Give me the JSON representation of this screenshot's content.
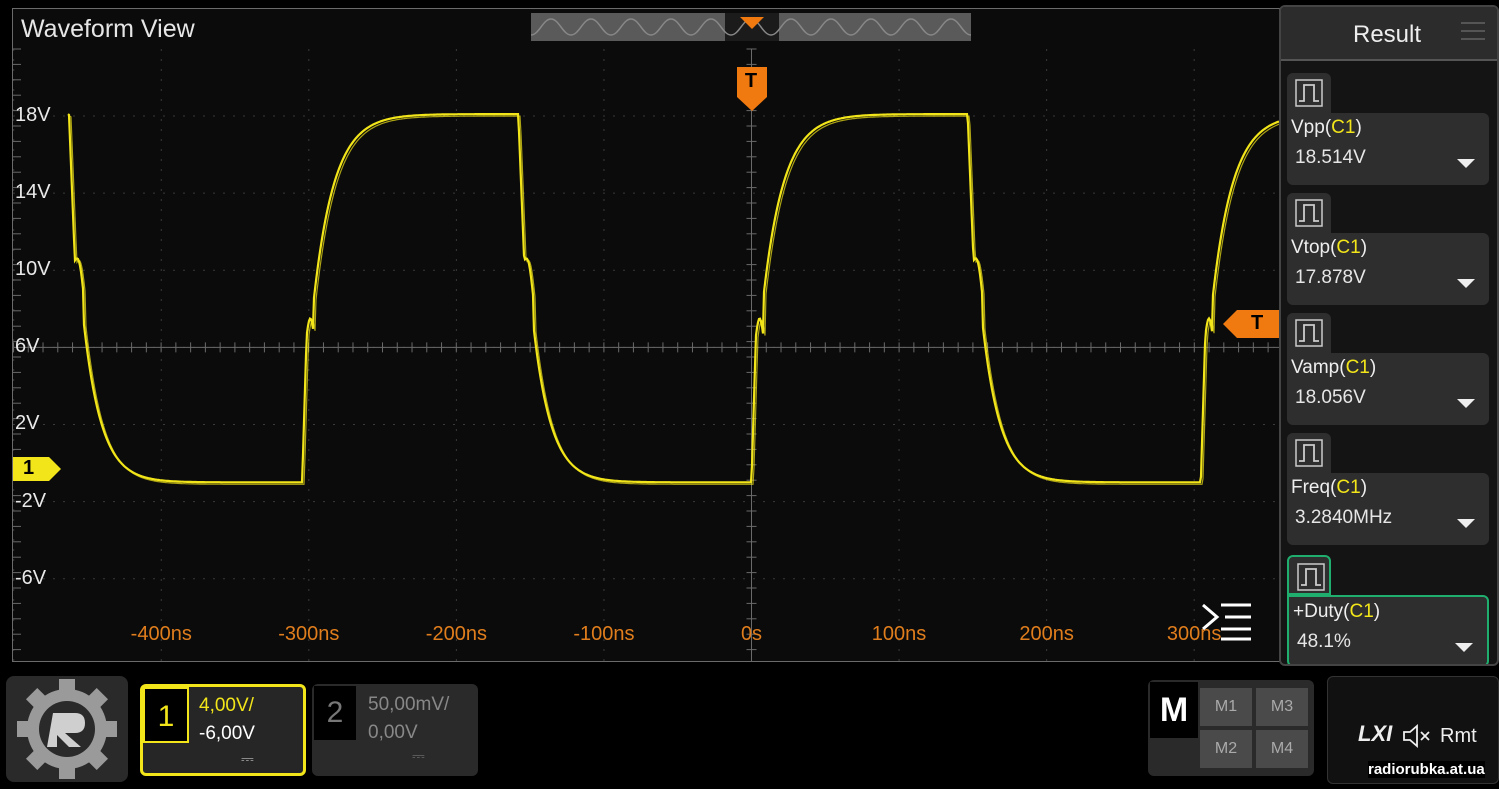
{
  "window": {
    "title": "Waveform View"
  },
  "colors": {
    "ch1": "#f2e51a",
    "trigger": "#f07a10",
    "time_labels": "#e07d1c",
    "active_border": "#1fae6e"
  },
  "waveform": {
    "volt_labels": [
      "18V",
      "14V",
      "10V",
      "6V",
      "2V",
      "-2V",
      "-6V"
    ],
    "time_labels": [
      "-400ns",
      "-300ns",
      "-200ns",
      "-100ns",
      "0s",
      "100ns",
      "200ns",
      "300ns"
    ],
    "channel_marker": "1",
    "trigger_marker": "T",
    "trigger_level_marker": "T"
  },
  "result_panel": {
    "title": "Result",
    "measurements": [
      {
        "name": "Vpp",
        "src": "C1",
        "value": "18.514V"
      },
      {
        "name": "Vtop",
        "src": "C1",
        "value": "17.878V"
      },
      {
        "name": "Vamp",
        "src": "C1",
        "value": "18.056V"
      },
      {
        "name": "Freq",
        "src": "C1",
        "value": "3.2840MHz"
      },
      {
        "name": "+Duty",
        "src": "C1",
        "value": "48.1%"
      }
    ]
  },
  "channels": {
    "ch1": {
      "number": "1",
      "scale": "4,00V/",
      "offset": "-6,00V",
      "coupling": "⎓"
    },
    "ch2": {
      "number": "2",
      "scale": "50,00mV/",
      "offset": "0,00V",
      "coupling": "⎓"
    }
  },
  "math": {
    "label": "M",
    "buttons": [
      "M1",
      "M3",
      "M2",
      "M4"
    ]
  },
  "status": {
    "lxi": "LXI",
    "mute_icon": "speaker-mute-icon",
    "rmt": "Rmt"
  },
  "watermark": "radiorubka.at.ua"
}
